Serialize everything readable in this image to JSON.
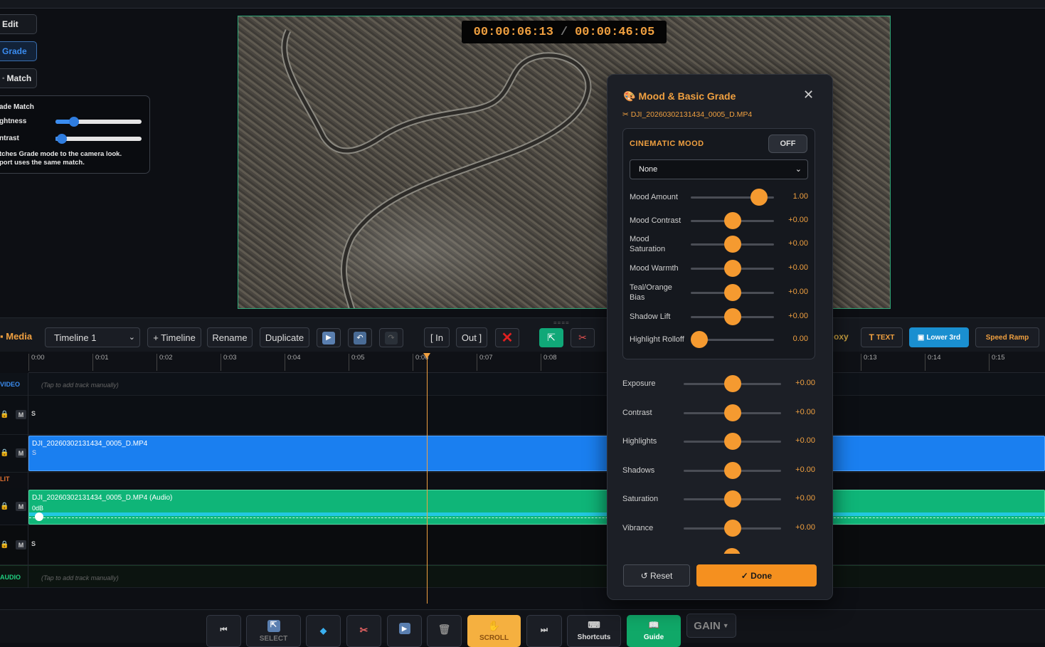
{
  "modes": {
    "edit": "Edit",
    "grade": "Grade",
    "match": "Match"
  },
  "match_panel": {
    "title": "ade Match",
    "brightness_label": "ghtness",
    "contrast_label": "ntrast",
    "brightness_level": 0.18,
    "contrast_level": 0.02,
    "note_line1": "tches Grade mode to the camera look.",
    "note_line2": "port uses the same match."
  },
  "viewer": {
    "current_time": "00:00:06:13",
    "separator": "/",
    "total_time": "00:00:46:05"
  },
  "toolbar": {
    "media": "Media",
    "timeline_select": "Timeline 1",
    "add_timeline": "+ Timeline",
    "rename": "Rename",
    "duplicate": "Duplicate",
    "mark_in": "[ In",
    "mark_out": "Out ]",
    "proxy": "oxy",
    "text": "TEXT",
    "lower_third": "Lower 3rd",
    "speed_ramp": "Speed Ramp"
  },
  "ruler": {
    "ticks": [
      "0:00",
      "0:01",
      "0:02",
      "0:03",
      "0:04",
      "0:05",
      "0:06",
      "0:07",
      "0:08",
      "0:13",
      "0:14",
      "0:15"
    ]
  },
  "tracks": {
    "video_label": "VIDEO",
    "audio_label": "AUDIO",
    "split_label": "LIT",
    "hint": "(Tap to add track manually)",
    "m": "M",
    "s": "S",
    "video_clip": "DJI_20260302131434_0005_D.MP4",
    "audio_clip": "DJI_20260302131434_0005_D.MP4 (Audio)",
    "audio_gain": "0dB"
  },
  "bottom": {
    "select": "SELECT",
    "scroll": "SCROLL",
    "shortcuts": "Shortcuts",
    "guide": "Guide",
    "gain": "GAIN"
  },
  "grade_panel": {
    "title": "Mood & Basic Grade",
    "file": "DJI_20260302131434_0005_D.MP4",
    "mood_heading": "CINEMATIC MOOD",
    "mood_toggle": "OFF",
    "mood_selected": "None",
    "mood_sliders": [
      {
        "label": "Mood Amount",
        "value": "1.00",
        "level": 0.9
      },
      {
        "label": "Mood Contrast",
        "value": "+0.00",
        "level": 0.5
      },
      {
        "label": "Mood Saturation",
        "value": "+0.00",
        "level": 0.5
      },
      {
        "label": "Mood Warmth",
        "value": "+0.00",
        "level": 0.5
      },
      {
        "label": "Teal/Orange Bias",
        "value": "+0.00",
        "level": 0.5
      },
      {
        "label": "Shadow Lift",
        "value": "+0.00",
        "level": 0.5
      },
      {
        "label": "Highlight Rolloff",
        "value": "0.00",
        "level": 0.0
      }
    ],
    "basic_sliders": [
      {
        "label": "Exposure",
        "value": "+0.00",
        "level": 0.5
      },
      {
        "label": "Contrast",
        "value": "+0.00",
        "level": 0.5
      },
      {
        "label": "Highlights",
        "value": "+0.00",
        "level": 0.5
      },
      {
        "label": "Shadows",
        "value": "+0.00",
        "level": 0.5
      },
      {
        "label": "Saturation",
        "value": "+0.00",
        "level": 0.5
      },
      {
        "label": "Vibrance",
        "value": "+0.00",
        "level": 0.5
      }
    ],
    "reset": "↺ Reset",
    "done": "✓ Done"
  },
  "colors": {
    "accent": "#f0a040",
    "video_clip": "#1a7ff0",
    "audio_clip": "#0fb578",
    "active_mode": "#3a8cf0"
  }
}
